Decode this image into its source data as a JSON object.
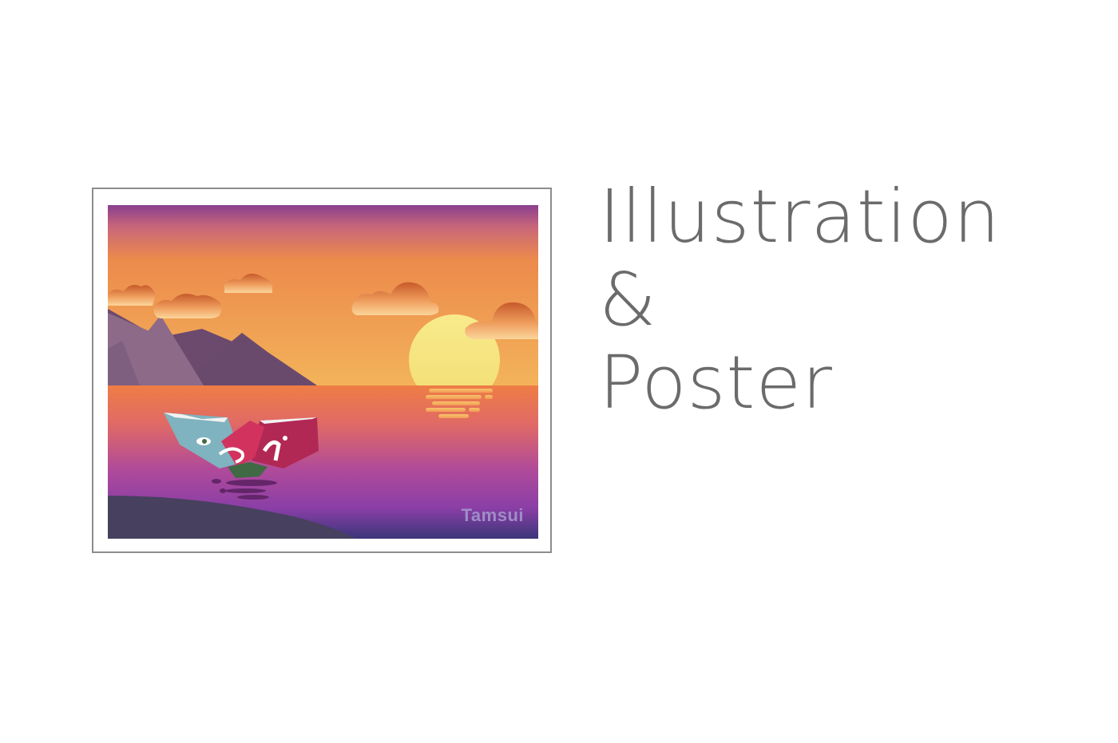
{
  "artwork": {
    "caption": "Tamsui",
    "caption_color": "#a08cc8"
  },
  "headline": {
    "line1": "Illustration",
    "line2": "&",
    "line3": "Poster",
    "color": "#6b6b6b"
  }
}
